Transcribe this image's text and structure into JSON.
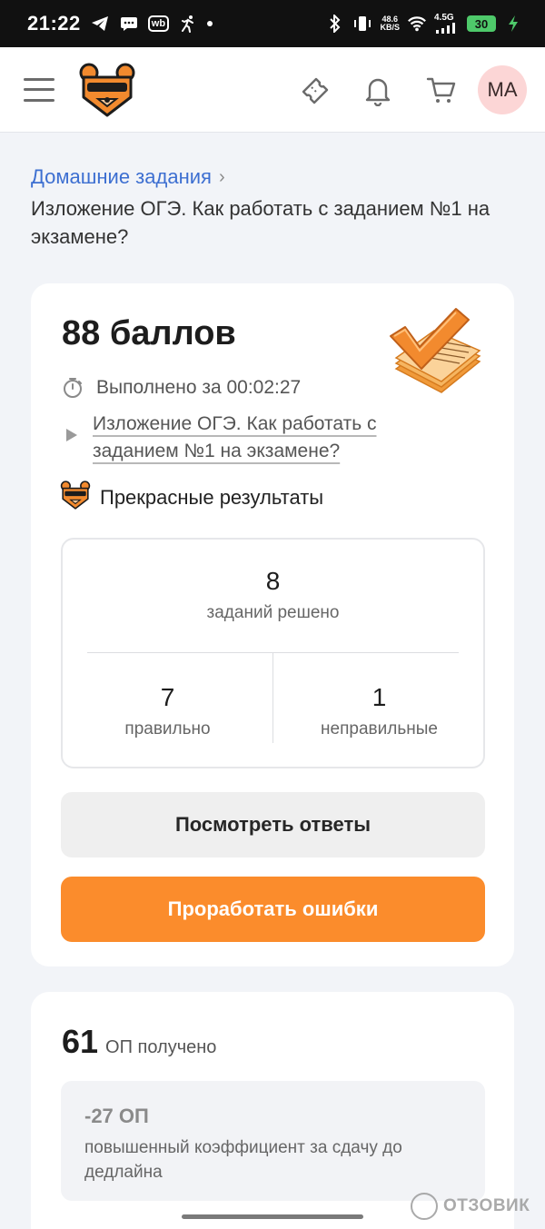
{
  "status_bar": {
    "time": "21:22",
    "wb_label": "wb",
    "net_speed_value": "48.6",
    "net_speed_unit": "KB/S",
    "signal_label": "4.5G",
    "battery": "30"
  },
  "header": {
    "avatar_initials": "MA"
  },
  "breadcrumb": {
    "link": "Домашние задания",
    "chevron": "›"
  },
  "page": {
    "title": "Изложение ОГЭ. Как работать с заданием №1 на экзамене?"
  },
  "result": {
    "score": "88 баллов",
    "time_text": "Выполнено за 00:02:27",
    "lesson_link": "Изложение ОГЭ. Как работать с заданием №1 на экзамене?",
    "rating": "Прекрасные результаты",
    "solved_count": "8",
    "solved_label": "заданий решено",
    "correct_count": "7",
    "correct_label": "правильно",
    "incorrect_count": "1",
    "incorrect_label": "неправильные",
    "view_answers_button": "Посмотреть ответы",
    "work_errors_button": "Проработать ошибки"
  },
  "op": {
    "value": "61",
    "label": "ОП получено",
    "penalty_value": "-27 ОП",
    "penalty_desc": "повышенный коэффициент за сдачу до дедлайна"
  },
  "watermark": {
    "text": "ОТЗОВИК"
  },
  "colors": {
    "accent_orange": "#fb8c2c",
    "link_blue": "#3d6fd1",
    "avatar_bg": "#fcd6d6"
  }
}
